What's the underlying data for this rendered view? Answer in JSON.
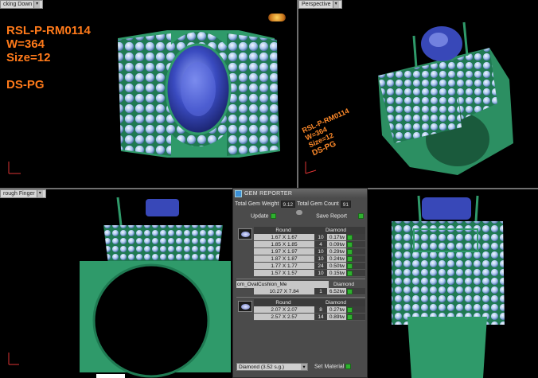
{
  "viewports": {
    "top_left": {
      "label": "cking Down"
    },
    "top_right": {
      "label": "Perspective"
    },
    "bottom_left": {
      "label": "rough Finger"
    },
    "bottom_right": {
      "label": ""
    }
  },
  "ring_info": {
    "model": "RSL-P-RM0114",
    "weight": "W=364",
    "size": "Size=12",
    "code": "DS-PG"
  },
  "colors": {
    "metal": "#2f9a6a",
    "gem_center": "#3848b8",
    "diamond": "#bcd6f5",
    "info_text": "#ff7a1a"
  },
  "gem_reporter": {
    "title": "GEM REPORTER",
    "total_weight_label": "Total Gem Weight",
    "total_weight": "9.12",
    "total_count_label": "Total Gem Count",
    "total_count": "91",
    "update_label": "Update",
    "save_report_label": "Save Report",
    "groups": [
      {
        "shape": "Round",
        "material": "Diamond",
        "rows": [
          {
            "size": "1.67 X 1.67",
            "count": "10",
            "ct": "0.17tw"
          },
          {
            "size": "1.85 X 1.85",
            "count": "4",
            "ct": "0.09tw"
          },
          {
            "size": "1.97 X 1.97",
            "count": "10",
            "ct": "0.29tw"
          },
          {
            "size": "1.87 X 1.87",
            "count": "10",
            "ct": "0.24tw"
          },
          {
            "size": "1.77 X 1.77",
            "count": "24",
            "ct": "0.50tw"
          },
          {
            "size": "1.57 X 1.57",
            "count": "10",
            "ct": "0.15tw"
          }
        ]
      },
      {
        "shape": "om_OvalCushion_Me",
        "material": "Diamond",
        "rows": [
          {
            "size": "10.27 X 7.84",
            "count": "1",
            "ct": "6.52tw"
          }
        ]
      },
      {
        "shape": "Round",
        "material": "Diamond",
        "rows": [
          {
            "size": "2.07 X 2.07",
            "count": "8",
            "ct": "0.27tw"
          },
          {
            "size": "2.57 X 2.57",
            "count": "14",
            "ct": "0.89tw"
          }
        ]
      }
    ],
    "material_select": "Diamond     (3.52 s.g.)",
    "set_material_label": "Set Material"
  },
  "info_rotated": {
    "model": "RSL-P-RM0114",
    "weight": "W=364",
    "size": "Size=12",
    "code": "DS-PG"
  }
}
